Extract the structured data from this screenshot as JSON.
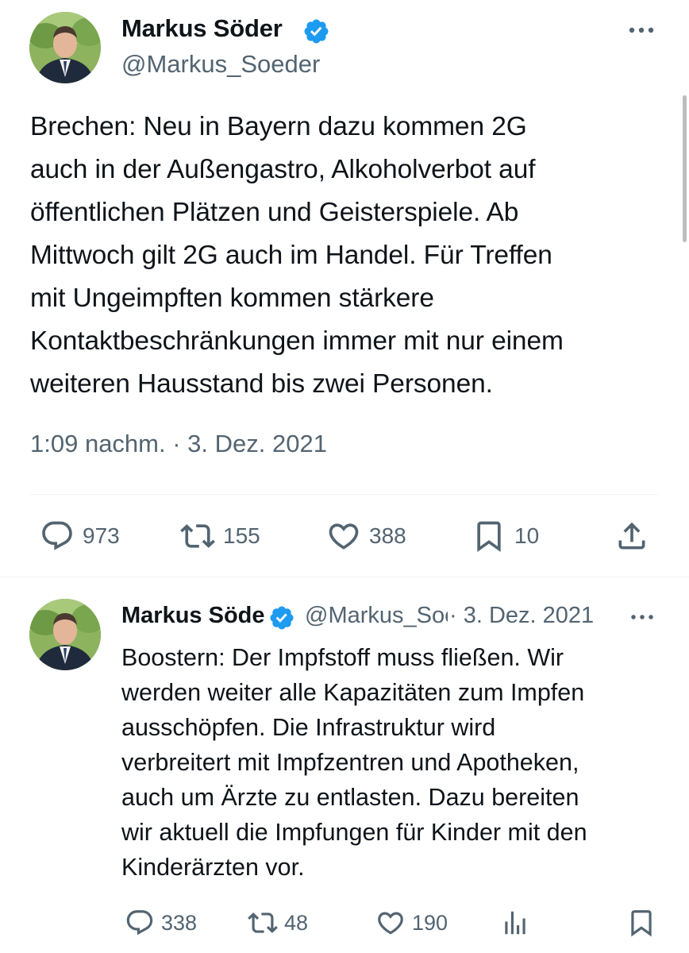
{
  "main_tweet": {
    "author_name": "Markus Söder",
    "handle": "@Markus_Soeder",
    "text_lines": [
      "Brechen: Neu in Bayern dazu kommen 2G",
      "auch in der Außengastro, Alkoholverbot auf",
      "öffentlichen Plätzen und Geisterspiele. Ab",
      "Mittwoch gilt 2G auch im Handel. Für Treffen",
      "mit Ungeimpften kommen stärkere",
      "Kontaktbeschränkungen immer mit nur einem",
      "weiteren Hausstand bis zwei Personen."
    ],
    "timestamp": "1:09 nachm. · 3. Dez. 2021",
    "actions": {
      "replies": "973",
      "retweets": "155",
      "likes": "388",
      "bookmarks": "10"
    },
    "icons": {
      "verified": "verified-badge-icon",
      "more": "more-icon",
      "reply": "reply-icon",
      "retweet": "retweet-icon",
      "like": "heart-icon",
      "bookmark": "bookmark-icon",
      "share": "share-icon"
    }
  },
  "reply_tweet": {
    "author_name": "Markus Söder",
    "handle": "@Markus_Soeder",
    "date": "· 3. Dez. 2021",
    "text_lines": [
      "Boostern: Der Impfstoff muss fließen. Wir",
      "werden weiter alle Kapazitäten zum Impfen",
      "ausschöpfen. Die Infrastruktur wird",
      "verbreitert mit Impfzentren und Apotheken,",
      "auch um Ärzte zu entlasten. Dazu bereiten",
      "wir aktuell die Impfungen für Kinder mit den",
      "Kinderärzten vor."
    ],
    "actions": {
      "replies": "338",
      "retweets": "48",
      "likes": "190"
    },
    "icons": {
      "views": "analytics-icon",
      "bookmark": "bookmark-icon"
    }
  },
  "colors": {
    "text_primary": "#0f1419",
    "text_secondary": "#536471",
    "verified_blue": "#1d9bf0",
    "divider": "#eff3f4"
  }
}
